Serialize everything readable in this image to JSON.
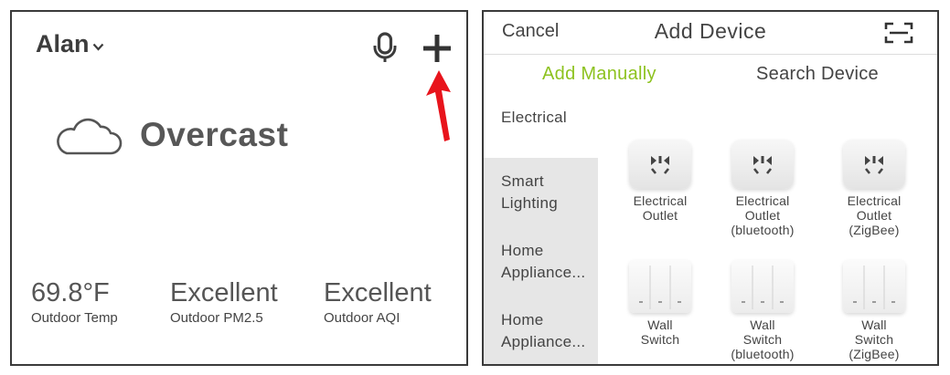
{
  "home": {
    "user_name": "Alan",
    "weather": "Overcast",
    "stats": [
      {
        "value": "69.8°F",
        "label": "Outdoor Temp"
      },
      {
        "value": "Excellent",
        "label": "Outdoor PM2.5"
      },
      {
        "value": "Excellent",
        "label": "Outdoor AQI"
      }
    ],
    "icons": {
      "user_menu": "chevron-down-icon",
      "voice": "microphone-icon",
      "add": "plus-icon",
      "weather": "cloud-icon",
      "annotation": "red-arrow"
    },
    "annotation_color": "#e8141c"
  },
  "add_device": {
    "cancel_label": "Cancel",
    "title": "Add Device",
    "scan_icon": "scan-icon",
    "tabs": [
      {
        "label": "Add Manually",
        "active": true
      },
      {
        "label": "Search Device",
        "active": false
      }
    ],
    "active_tab_color": "#8dc21f",
    "categories": [
      "Electrical",
      "Smart Lighting",
      "Home Appliance...",
      "Home Appliance..."
    ],
    "devices": [
      {
        "lines": [
          "Electrical",
          "Outlet"
        ],
        "icon": "outlet-icon"
      },
      {
        "lines": [
          "Electrical",
          "Outlet",
          "(bluetooth)"
        ],
        "icon": "outlet-icon"
      },
      {
        "lines": [
          "Electrical",
          "Outlet",
          "(ZigBee)"
        ],
        "icon": "outlet-icon"
      },
      {
        "lines": [
          "Wall",
          "Switch"
        ],
        "icon": "wall-switch-icon"
      },
      {
        "lines": [
          "Wall",
          "Switch",
          "(bluetooth)"
        ],
        "icon": "wall-switch-icon"
      },
      {
        "lines": [
          "Wall",
          "Switch",
          "(ZigBee)"
        ],
        "icon": "wall-switch-icon"
      }
    ]
  }
}
